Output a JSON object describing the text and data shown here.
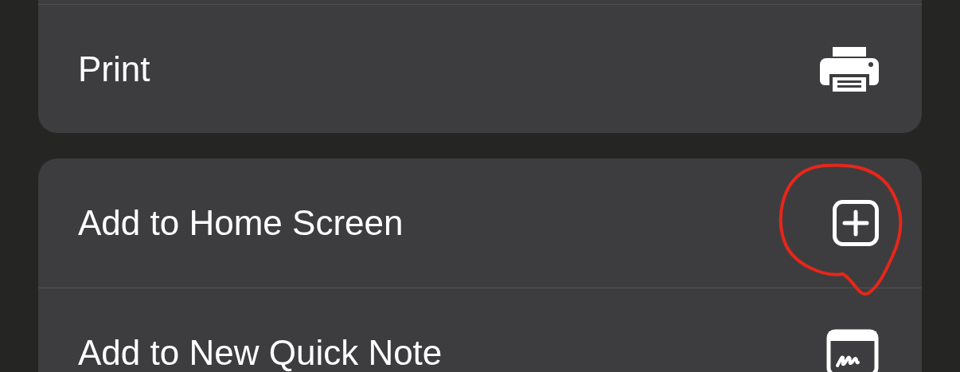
{
  "groups": [
    {
      "items": [
        {
          "label": "Print",
          "kind": "printer"
        }
      ]
    },
    {
      "items": [
        {
          "label": "Add to Home Screen",
          "kind": "add-square"
        },
        {
          "label": "Add to New Quick Note",
          "kind": "quick-note"
        }
      ]
    }
  ]
}
